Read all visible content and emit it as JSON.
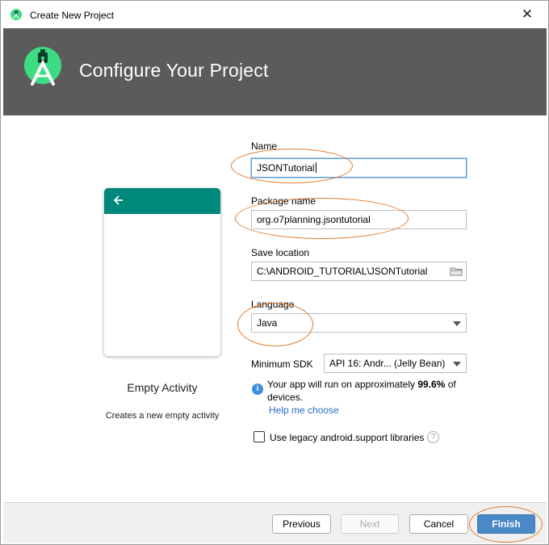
{
  "window": {
    "title": "Create New Project"
  },
  "header": {
    "title": "Configure Your Project"
  },
  "template": {
    "activity_name": "Empty Activity",
    "activity_desc": "Creates a new empty activity"
  },
  "form": {
    "name": {
      "label": "Name",
      "value": "JSONTutorial"
    },
    "package": {
      "label": "Package name",
      "value": "org.o7planning.jsontutorial"
    },
    "save_location": {
      "label": "Save location",
      "value": "C:\\ANDROID_TUTORIAL\\JSONTutorial"
    },
    "language": {
      "label": "Language",
      "value": "Java"
    },
    "min_sdk": {
      "label": "Minimum SDK",
      "value": "API 16: Andr... (Jelly Bean)"
    },
    "info": {
      "text_before": "Your app will run on approximately ",
      "percent": "99.6%",
      "text_after": " of devices."
    },
    "help_link": "Help me choose",
    "legacy_checkbox": {
      "label": "Use legacy android.support libraries",
      "checked": false
    }
  },
  "buttons": {
    "previous": "Previous",
    "next": "Next",
    "cancel": "Cancel",
    "finish": "Finish"
  },
  "colors": {
    "header_bg": "#5b5b5b",
    "android_green": "#3ddc84",
    "phone_bar": "#00897b",
    "accent": "#4a88c7",
    "annotation": "#e07a2b"
  },
  "icons": {
    "title_logo": "android-studio-icon",
    "header_logo": "android-studio-logo",
    "close": "close-icon",
    "back": "arrow-left-icon",
    "folder": "folder-icon",
    "dropdown": "chevron-down-icon",
    "info": "info-icon",
    "help": "question-mark-icon"
  }
}
